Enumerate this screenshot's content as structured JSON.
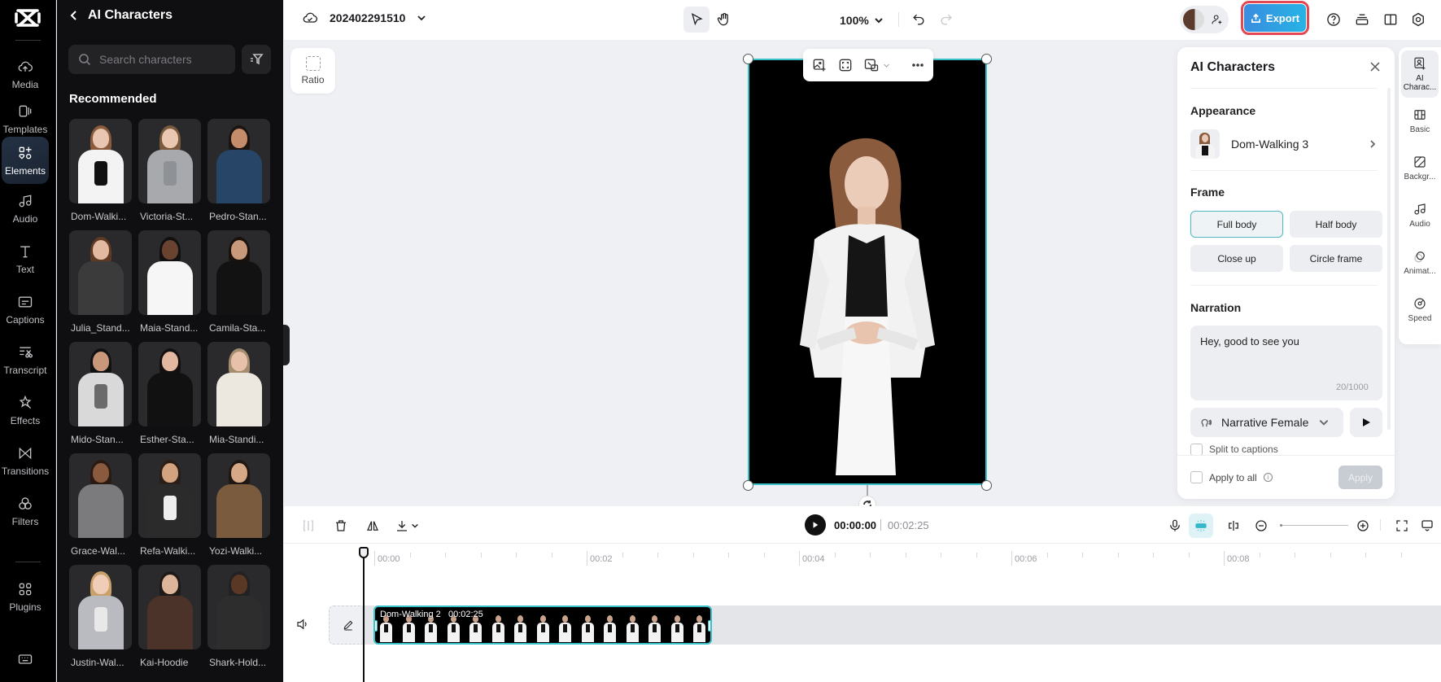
{
  "rail": {
    "items": [
      {
        "label": "Media",
        "icon": "cloud-upload-icon"
      },
      {
        "label": "Templates",
        "icon": "templates-icon"
      },
      {
        "label": "Elements",
        "icon": "elements-icon",
        "active": true
      },
      {
        "label": "Audio",
        "icon": "music-note-icon"
      },
      {
        "label": "Text",
        "icon": "text-icon"
      },
      {
        "label": "Captions",
        "icon": "captions-icon"
      },
      {
        "label": "Transcript",
        "icon": "transcript-icon"
      },
      {
        "label": "Effects",
        "icon": "effects-star-icon"
      },
      {
        "label": "Transitions",
        "icon": "transitions-icon"
      },
      {
        "label": "Filters",
        "icon": "filters-icon"
      },
      {
        "label": "Plugins",
        "icon": "plugins-grid-icon"
      }
    ],
    "keyboard_icon": "keyboard-icon"
  },
  "panel": {
    "title": "AI Characters",
    "search_placeholder": "Search characters",
    "section": "Recommended",
    "characters": [
      {
        "name": "Dom-Walki...",
        "skin": "#e8c6b2",
        "hair": "#8a5b3c",
        "top": "#f3f3f3",
        "inner": "#111111"
      },
      {
        "name": "Victoria-St...",
        "skin": "#e9c7b0",
        "hair": "#7a5a3c",
        "top": "#a7a9ad",
        "inner": "#8e9196"
      },
      {
        "name": "Pedro-Stan...",
        "skin": "#c48c6a",
        "hair": "#1c1410",
        "top": "#274566",
        "inner": "#274566"
      },
      {
        "name": "Julia_Stand...",
        "skin": "#e4b9a1",
        "hair": "#5e3a25",
        "top": "#3b3b3b",
        "inner": "#3b3b3b"
      },
      {
        "name": "Maia-Stand...",
        "skin": "#6a4330",
        "hair": "#111111",
        "top": "#f6f6f6",
        "inner": "#f6f6f6"
      },
      {
        "name": "Camila-Sta...",
        "skin": "#c9997b",
        "hair": "#1a120d",
        "top": "#121212",
        "inner": "#121212"
      },
      {
        "name": "Mido-Stan...",
        "skin": "#c9977a",
        "hair": "#111111",
        "top": "#d9d9d9",
        "inner": "#6a6a6a"
      },
      {
        "name": "Esther-Sta...",
        "skin": "#e2b9a0",
        "hair": "#141010",
        "top": "#111111",
        "inner": "#111111"
      },
      {
        "name": "Mia-Standi...",
        "skin": "#e8c1aa",
        "hair": "#a48d6f",
        "top": "#ede8df",
        "inner": "#ede8df"
      },
      {
        "name": "Grace-Wal...",
        "skin": "#8a5a3e",
        "hair": "#2a1a12",
        "top": "#7b7b7e",
        "inner": "#7b7b7e"
      },
      {
        "name": "Refa-Walki...",
        "skin": "#d3a27f",
        "hair": "#2a1f18",
        "top": "#2b2b2b",
        "inner": "#eeeeee"
      },
      {
        "name": "Yozi-Walki...",
        "skin": "#d5a888",
        "hair": "#211712",
        "top": "#7a5b3d",
        "inner": "#7a5b3d"
      },
      {
        "name": "Justin-Wal...",
        "skin": "#efcdb6",
        "hair": "#c9a26b",
        "top": "#b9bbc0",
        "inner": "#e8e8e8"
      },
      {
        "name": "Kai-Hoodie",
        "skin": "#dcb59b",
        "hair": "#1e1a17",
        "top": "#4c3329",
        "inner": "#4c3329"
      },
      {
        "name": "Shark-Hold...",
        "skin": "#5a3826",
        "hair": "#222222",
        "top": "#2d2d2d",
        "inner": "#2d2d2d"
      }
    ]
  },
  "topbar": {
    "project_name": "202402291510",
    "zoom": "100%",
    "export_label": "Export",
    "icons": [
      "cloud-check-icon",
      "chevron-down-icon",
      "pointer-icon",
      "hand-icon",
      "undo-icon",
      "redo-icon",
      "avatar",
      "add-user-icon",
      "help-icon",
      "layers-icon",
      "layout-icon",
      "settings-icon"
    ]
  },
  "canvas": {
    "ratio_label": "Ratio",
    "selected_element": "Dom-Walking 3"
  },
  "props": {
    "title": "AI Characters",
    "appearance_label": "Appearance",
    "appearance_value": "Dom-Walking 3",
    "frame_label": "Frame",
    "frame_options": [
      "Full body",
      "Half body",
      "Close up",
      "Circle frame"
    ],
    "frame_selected": "Full body",
    "narration_label": "Narration",
    "narration_text": "Hey, good to see you",
    "narration_count": "20/1000",
    "voice": "Narrative Female",
    "split_captions": "Split to captions",
    "apply_all": "Apply to all",
    "apply": "Apply"
  },
  "right_tabs": [
    {
      "label": "AI Charac...",
      "active": true
    },
    {
      "label": "Basic"
    },
    {
      "label": "Backgr..."
    },
    {
      "label": "Audio"
    },
    {
      "label": "Animat..."
    },
    {
      "label": "Speed"
    }
  ],
  "timeline": {
    "current_time": "00:00:00",
    "total_time": "00:02:25",
    "ruler_labels": [
      "00:00",
      "00:02",
      "00:04",
      "00:06",
      "00:08"
    ],
    "clip_name": "Dom-Walking 2",
    "clip_duration": "00:02:25",
    "zoom_level": 0
  }
}
